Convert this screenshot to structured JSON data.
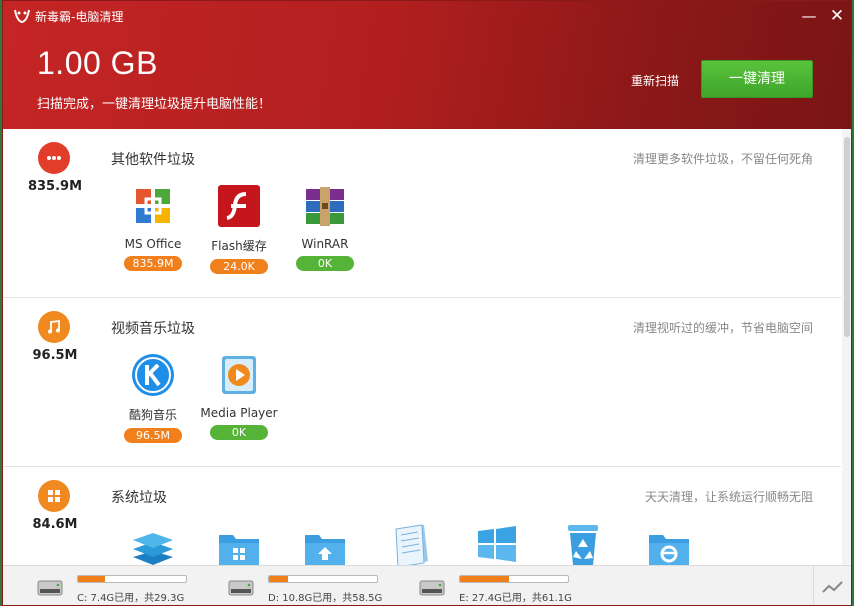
{
  "window": {
    "title": "新毒霸-电脑清理",
    "minimize": "—",
    "close": "✕"
  },
  "header": {
    "total_size": "1.00 GB",
    "message": "扫描完成，一键清理垃圾提升电脑性能！",
    "rescan_label": "重新扫描",
    "clean_label": "一键清理"
  },
  "sections": [
    {
      "icon": "more-dots-icon",
      "size": "835.9M",
      "title": "其他软件垃圾",
      "desc": "清理更多软件垃圾，不留任何死角",
      "items": [
        {
          "name": "MS Office",
          "size": "835.9M",
          "badge": "orange",
          "icon": "ms-office-icon"
        },
        {
          "name": "Flash缓存",
          "size": "24.0K",
          "badge": "orange",
          "icon": "flash-icon"
        },
        {
          "name": "WinRAR",
          "size": "0K",
          "badge": "green",
          "icon": "winrar-icon"
        }
      ]
    },
    {
      "icon": "music-note-icon",
      "size": "96.5M",
      "title": "视频音乐垃圾",
      "desc": "清理视听过的缓冲，节省电脑空间",
      "items": [
        {
          "name": "酷狗音乐",
          "size": "96.5M",
          "badge": "orange",
          "icon": "kugou-icon"
        },
        {
          "name": "Media Player",
          "size": "0K",
          "badge": "green",
          "icon": "media-player-icon"
        }
      ]
    },
    {
      "icon": "windows-logo-icon",
      "size": "84.6M",
      "title": "系统垃圾",
      "desc": "天天清理，让系统运行顺畅无阻",
      "items": [
        {
          "icon": "layers-icon"
        },
        {
          "icon": "windows-folder-icon"
        },
        {
          "icon": "upload-folder-icon"
        },
        {
          "icon": "notepad-icon"
        },
        {
          "icon": "windows-tiles-icon"
        },
        {
          "icon": "recycle-bin-icon"
        },
        {
          "icon": "ie-folder-icon"
        }
      ]
    }
  ],
  "drives": [
    {
      "label": "C: 7.4G已用，共29.3G",
      "used_fraction": 0.25
    },
    {
      "label": "D: 10.8G已用，共58.5G",
      "used_fraction": 0.18
    },
    {
      "label": "E: 27.4G已用，共61.1G",
      "used_fraction": 0.45
    }
  ],
  "colors": {
    "header_red": "#b21f1f",
    "clean_green": "#4db332",
    "badge_orange": "#f07f1c",
    "badge_green": "#55b437"
  }
}
